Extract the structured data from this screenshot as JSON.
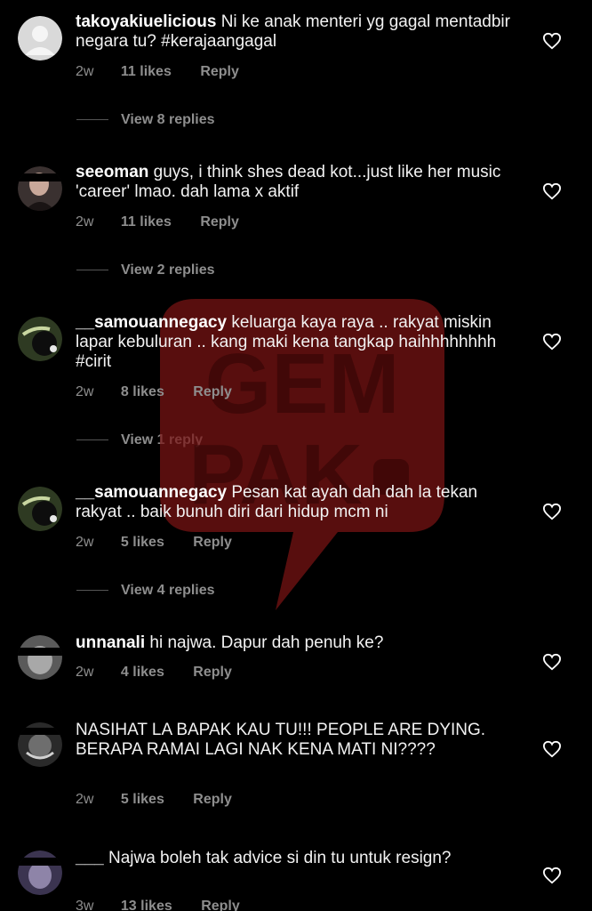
{
  "comments": [
    {
      "username": "takoyakiuelicious",
      "text": "Ni ke anak menteri yg gagal mentadbir negara tu? #kerajaangagal",
      "time": "2w",
      "likes": "11 likes",
      "reply": "Reply",
      "view_replies": "View 8 replies"
    },
    {
      "username": "seeoman",
      "text": "guys, i think shes dead kot...just like her music 'career' lmao. dah lama x aktif",
      "time": "2w",
      "likes": "11 likes",
      "reply": "Reply",
      "view_replies": "View 2 replies"
    },
    {
      "username": "__samouannegacy",
      "text": "keluarga kaya raya .. rakyat miskin lapar kebuluran .. kang maki kena tangkap haihhhhhhhh #cirit",
      "time": "2w",
      "likes": "8 likes",
      "reply": "Reply",
      "view_replies": "View 1 reply"
    },
    {
      "username": "__samouannegacy",
      "text": "Pesan kat ayah dah dah la tekan rakyat .. baik bunuh diri dari hidup mcm ni",
      "time": "2w",
      "likes": "5 likes",
      "reply": "Reply",
      "view_replies": "View 4 replies"
    },
    {
      "username": "unnanali",
      "text": "hi najwa. Dapur dah penuh ke?",
      "time": "2w",
      "likes": "4 likes",
      "reply": "Reply"
    },
    {
      "username": "",
      "text": "NASIHAT LA BAPAK KAU TU!!! PEOPLE ARE DYING. BERAPA RAMAI LAGI NAK KENA MATI NI????",
      "time": "2w",
      "likes": "5 likes",
      "reply": "Reply"
    },
    {
      "username": "___",
      "text": "Najwa boleh tak advice si din tu untuk resign?",
      "time": "3w",
      "likes": "13 likes",
      "reply": "Reply"
    }
  ],
  "watermark": {
    "line1": "GEM",
    "line2": "PAK",
    "color": "#8b1a1a"
  },
  "icons": {
    "like": "heart-outline-icon",
    "avatar_default": "default-avatar-icon"
  }
}
